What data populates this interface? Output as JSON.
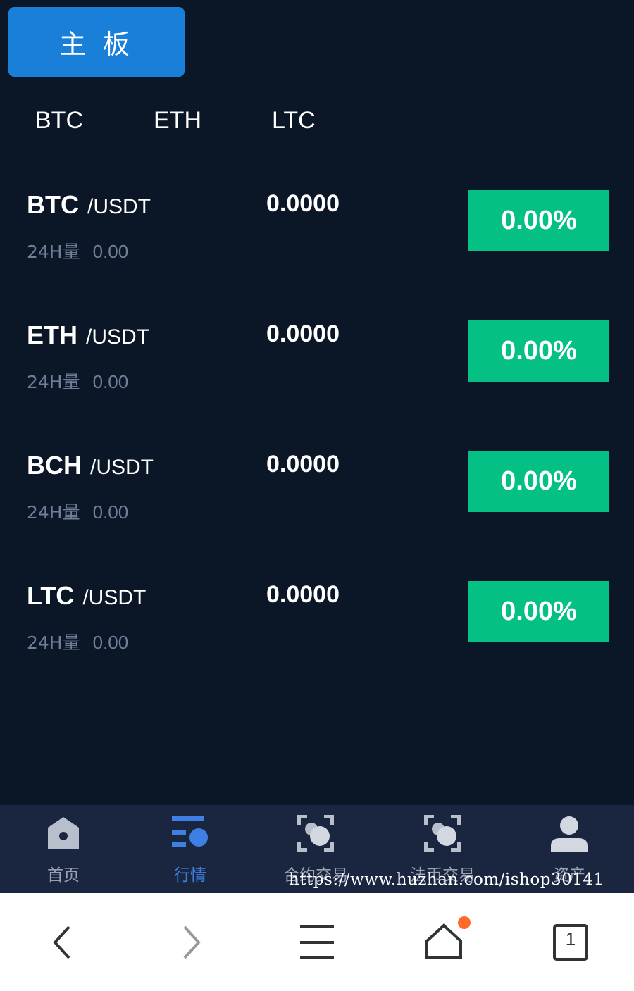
{
  "board_button": "主 板",
  "tabs": [
    "BTC",
    "ETH",
    "LTC"
  ],
  "rows": [
    {
      "base": "BTC",
      "quote": "/USDT",
      "vol_label": "24H量",
      "vol_value": "0.00",
      "price": "0.0000",
      "change": "0.00%"
    },
    {
      "base": "ETH",
      "quote": "/USDT",
      "vol_label": "24H量",
      "vol_value": "0.00",
      "price": "0.0000",
      "change": "0.00%"
    },
    {
      "base": "BCH",
      "quote": "/USDT",
      "vol_label": "24H量",
      "vol_value": "0.00",
      "price": "0.0000",
      "change": "0.00%"
    },
    {
      "base": "LTC",
      "quote": "/USDT",
      "vol_label": "24H量",
      "vol_value": "0.00",
      "price": "0.0000",
      "change": "0.00%"
    }
  ],
  "tabbar": [
    {
      "label": "首页",
      "icon": "home-icon"
    },
    {
      "label": "行情",
      "icon": "market-icon",
      "active": true
    },
    {
      "label": "合约交易",
      "icon": "contract-trade-icon"
    },
    {
      "label": "法币交易",
      "icon": "fiat-trade-icon"
    },
    {
      "label": "资产",
      "icon": "user-icon"
    }
  ],
  "watermark": "https://www.huzhan.com/ishop30141",
  "browser": {
    "tab_count": "1",
    "icons": [
      "back-icon",
      "forward-icon",
      "menu-icon",
      "home-icon",
      "tabs-icon"
    ]
  },
  "colors": {
    "background": "#0b1626",
    "accent_button": "#1a7fd9",
    "change_green": "#05c085",
    "tabbar_bg": "#1a2640",
    "tabbar_active": "#3e7fe3",
    "notify_dot": "#ff6a2b"
  }
}
